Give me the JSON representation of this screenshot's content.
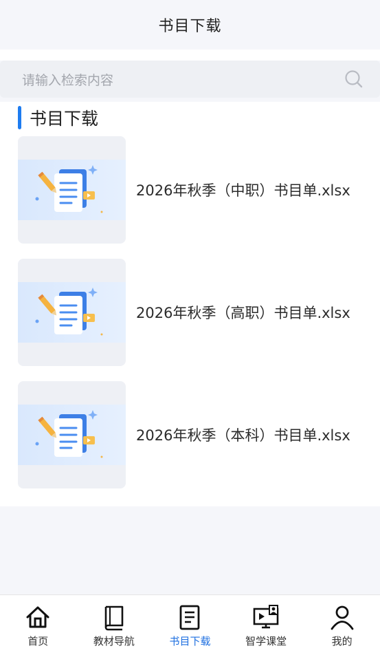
{
  "header": {
    "title": "书目下载"
  },
  "search": {
    "placeholder": "请输入检索内容"
  },
  "section": {
    "title": "书目下载"
  },
  "files": [
    {
      "name": "2026年秋季（中职）书目单.xlsx"
    },
    {
      "name": "2026年秋季（高职）书目单.xlsx"
    },
    {
      "name": "2026年秋季（本科）书目单.xlsx"
    }
  ],
  "tabbar": {
    "tabs": [
      {
        "label": "首页",
        "icon": "home-icon"
      },
      {
        "label": "教材导航",
        "icon": "book-icon"
      },
      {
        "label": "书目下载",
        "icon": "document-icon",
        "active": true
      },
      {
        "label": "智学课堂",
        "icon": "classroom-icon"
      },
      {
        "label": "我的",
        "icon": "user-icon"
      }
    ]
  },
  "colors": {
    "accent": "#1e7cf0",
    "active_tab": "#1e6fe0",
    "background": "#f5f6fa"
  }
}
